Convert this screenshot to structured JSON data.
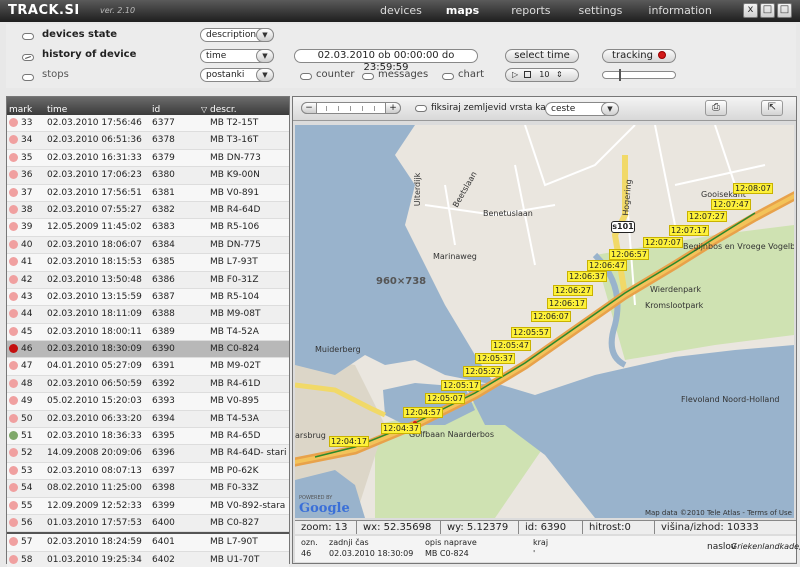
{
  "app": {
    "logo": "TRACK.SI",
    "version": "ver. 2.10"
  },
  "nav": [
    {
      "label": "devices",
      "active": false
    },
    {
      "label": "maps",
      "active": true
    },
    {
      "label": "reports",
      "active": false
    },
    {
      "label": "settings",
      "active": false
    },
    {
      "label": "information",
      "active": false
    }
  ],
  "window_buttons": [
    "x",
    "□",
    "□"
  ],
  "controls": {
    "devices_state": "devices state",
    "devices_state_select": "description",
    "history_label": "history of device",
    "history_select": "time",
    "date_range": "02.03.2010 ob 00:00:00 do 23:59:59",
    "select_time_btn": "select time",
    "tracking_btn": "tracking",
    "stops_label": "stops",
    "stops_select": "postanki",
    "counter_label": "counter",
    "messages_label": "messages",
    "chart_label": "chart",
    "player_value": "10"
  },
  "list": {
    "headers": {
      "mark": "mark",
      "time": "time",
      "id": "id",
      "descr": "descr."
    },
    "rows": [
      {
        "mark": "33",
        "time": "02.03.2010 17:56:46",
        "id": "6377",
        "descr": "MB T2-15T",
        "color": "#f0a0a0"
      },
      {
        "mark": "34",
        "time": "02.03.2010 06:51:36",
        "id": "6378",
        "descr": "MB T3-16T",
        "color": "#f0a0a0"
      },
      {
        "mark": "35",
        "time": "02.03.2010 16:31:33",
        "id": "6379",
        "descr": "MB DN-773",
        "color": "#f0a0a0"
      },
      {
        "mark": "36",
        "time": "02.03.2010 17:06:23",
        "id": "6380",
        "descr": "MB K9-00N",
        "color": "#f0a0a0"
      },
      {
        "mark": "37",
        "time": "02.03.2010 17:56:51",
        "id": "6381",
        "descr": "MB V0-891",
        "color": "#f0a0a0"
      },
      {
        "mark": "38",
        "time": "02.03.2010 07:55:27",
        "id": "6382",
        "descr": "MB R4-64D",
        "color": "#f0a0a0"
      },
      {
        "mark": "39",
        "time": "12.05.2009 11:45:02",
        "id": "6383",
        "descr": "MB R5-106",
        "color": "#f0a0a0"
      },
      {
        "mark": "40",
        "time": "02.03.2010 18:06:07",
        "id": "6384",
        "descr": "MB DN-775",
        "color": "#f0a0a0"
      },
      {
        "mark": "41",
        "time": "02.03.2010 18:15:53",
        "id": "6385",
        "descr": "MB L7-93T",
        "color": "#f0a0a0"
      },
      {
        "mark": "42",
        "time": "02.03.2010 13:50:48",
        "id": "6386",
        "descr": "MB F0-31Z",
        "color": "#f0a0a0"
      },
      {
        "mark": "43",
        "time": "02.03.2010 13:15:59",
        "id": "6387",
        "descr": "MB R5-104",
        "color": "#f0a0a0"
      },
      {
        "mark": "44",
        "time": "02.03.2010 18:11:09",
        "id": "6388",
        "descr": "MB M9-08T",
        "color": "#f0a0a0"
      },
      {
        "mark": "45",
        "time": "02.03.2010 18:00:11",
        "id": "6389",
        "descr": "MB T4-52A",
        "color": "#f0a0a0"
      },
      {
        "mark": "46",
        "time": "02.03.2010 18:30:09",
        "id": "6390",
        "descr": "MB C0-824",
        "color": "#c40f0f",
        "selected": true
      },
      {
        "mark": "47",
        "time": "04.01.2010 05:27:09",
        "id": "6391",
        "descr": "MB M9-02T",
        "color": "#f0a0a0"
      },
      {
        "mark": "48",
        "time": "02.03.2010 06:50:59",
        "id": "6392",
        "descr": "MB R4-61D",
        "color": "#f0a0a0"
      },
      {
        "mark": "49",
        "time": "05.02.2010 15:20:03",
        "id": "6393",
        "descr": "MB V0-895",
        "color": "#f0a0a0"
      },
      {
        "mark": "50",
        "time": "02.03.2010 06:33:20",
        "id": "6394",
        "descr": "MB T4-53A",
        "color": "#f0a0a0"
      },
      {
        "mark": "51",
        "time": "02.03.2010 18:36:33",
        "id": "6395",
        "descr": "MB R4-65D",
        "color": "#7fa86a"
      },
      {
        "mark": "52",
        "time": "14.09.2008 20:09:06",
        "id": "6396",
        "descr": "MB R4-64D- stari",
        "color": "#f0a0a0"
      },
      {
        "mark": "53",
        "time": "02.03.2010 08:07:13",
        "id": "6397",
        "descr": "MB P0-62K",
        "color": "#f0a0a0"
      },
      {
        "mark": "54",
        "time": "08.02.2010 11:25:00",
        "id": "6398",
        "descr": "MB F0-33Z",
        "color": "#f0a0a0"
      },
      {
        "mark": "55",
        "time": "12.09.2009 12:52:33",
        "id": "6399",
        "descr": "MB V0-892-stara",
        "color": "#f0a0a0"
      },
      {
        "mark": "56",
        "time": "01.03.2010 17:57:53",
        "id": "6400",
        "descr": "MB C0-827",
        "color": "#f0a0a0"
      }
    ],
    "pinned_rows": [
      {
        "mark": "57",
        "time": "02.03.2010 18:24:59",
        "id": "6401",
        "descr": "MB L7-90T",
        "color": "#f0a0a0"
      },
      {
        "mark": "58",
        "time": "01.03.2010 19:25:34",
        "id": "6402",
        "descr": "MB U1-70T",
        "color": "#f0a0a0"
      }
    ]
  },
  "map": {
    "fix_label": "fiksiraj zemljevid vrsta karte",
    "map_type_select": "ceste",
    "dimension_label": "960×738",
    "shield": "s101",
    "credit": "Map data ©2010 Tele Atlas - Terms of Use",
    "google": "Google",
    "powered_by": "POWERED BY",
    "places": [
      "Gooisekant",
      "Kromslootpark",
      "Begijnbos en Vroege Vogelbos",
      "Wierdenpark",
      "Muiderberg",
      "Golfbaan Naarderbos",
      "Flevoland Noord-Holland",
      "Benetuslaan",
      "Marinaweg",
      "Uiterdijk",
      "Hogering",
      "arsbrug",
      "Beetslaan"
    ],
    "time_labels": [
      "12:08:07",
      "12:07:47",
      "12:07:27",
      "12:07:17",
      "12:07:07",
      "12:06:57",
      "12:06:47",
      "12:06:37",
      "12:06:27",
      "12:06:17",
      "12:06:07",
      "12:05:57",
      "12:05:47",
      "12:05:37",
      "12:05:27",
      "12:05:17",
      "12:05:07",
      "12:04:57",
      "12:04:37",
      "12:04:17"
    ]
  },
  "status": {
    "zoom": "zoom: 13",
    "wx": "wx: 52.35698",
    "wy": "wy: 5.12379",
    "id": "id: 6390",
    "hitrost": "hitrost:0",
    "visina": "višina/izhod: 10333"
  },
  "info": {
    "col_ozn": "ozn.",
    "col_time": "zadnji čas",
    "col_desc": "opis naprave",
    "col_kraj": "kraj",
    "col_naslov": "naslov",
    "ozn": "46",
    "time": "02.03.2010 18:30:09",
    "desc": "MB C0-824",
    "kraj": "'",
    "naslov": "Griekenlandkade,"
  }
}
